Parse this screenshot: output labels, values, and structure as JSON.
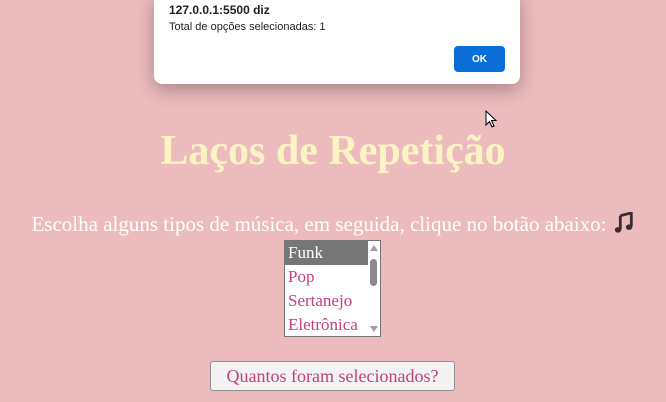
{
  "alert": {
    "title": "127.0.0.1:5500 diz",
    "message": "Total de opções selecionadas: 1",
    "ok_label": "OK"
  },
  "page": {
    "title": "Laços de Repetição",
    "instruction": "Escolha alguns tipos de música, em seguida, clique no botão abaixo:",
    "instruction_icon": "music-notes-icon",
    "options": [
      {
        "label": "Funk",
        "selected": true
      },
      {
        "label": "Pop",
        "selected": false
      },
      {
        "label": "Sertanejo",
        "selected": false
      },
      {
        "label": "Eletrônica",
        "selected": false
      }
    ],
    "button_label": "Quantos foram selecionados?"
  },
  "colors": {
    "background": "#ebbbbd",
    "title": "#fbf3c2",
    "option_text": "#c2407e",
    "ok_button": "#0b6ed6"
  }
}
